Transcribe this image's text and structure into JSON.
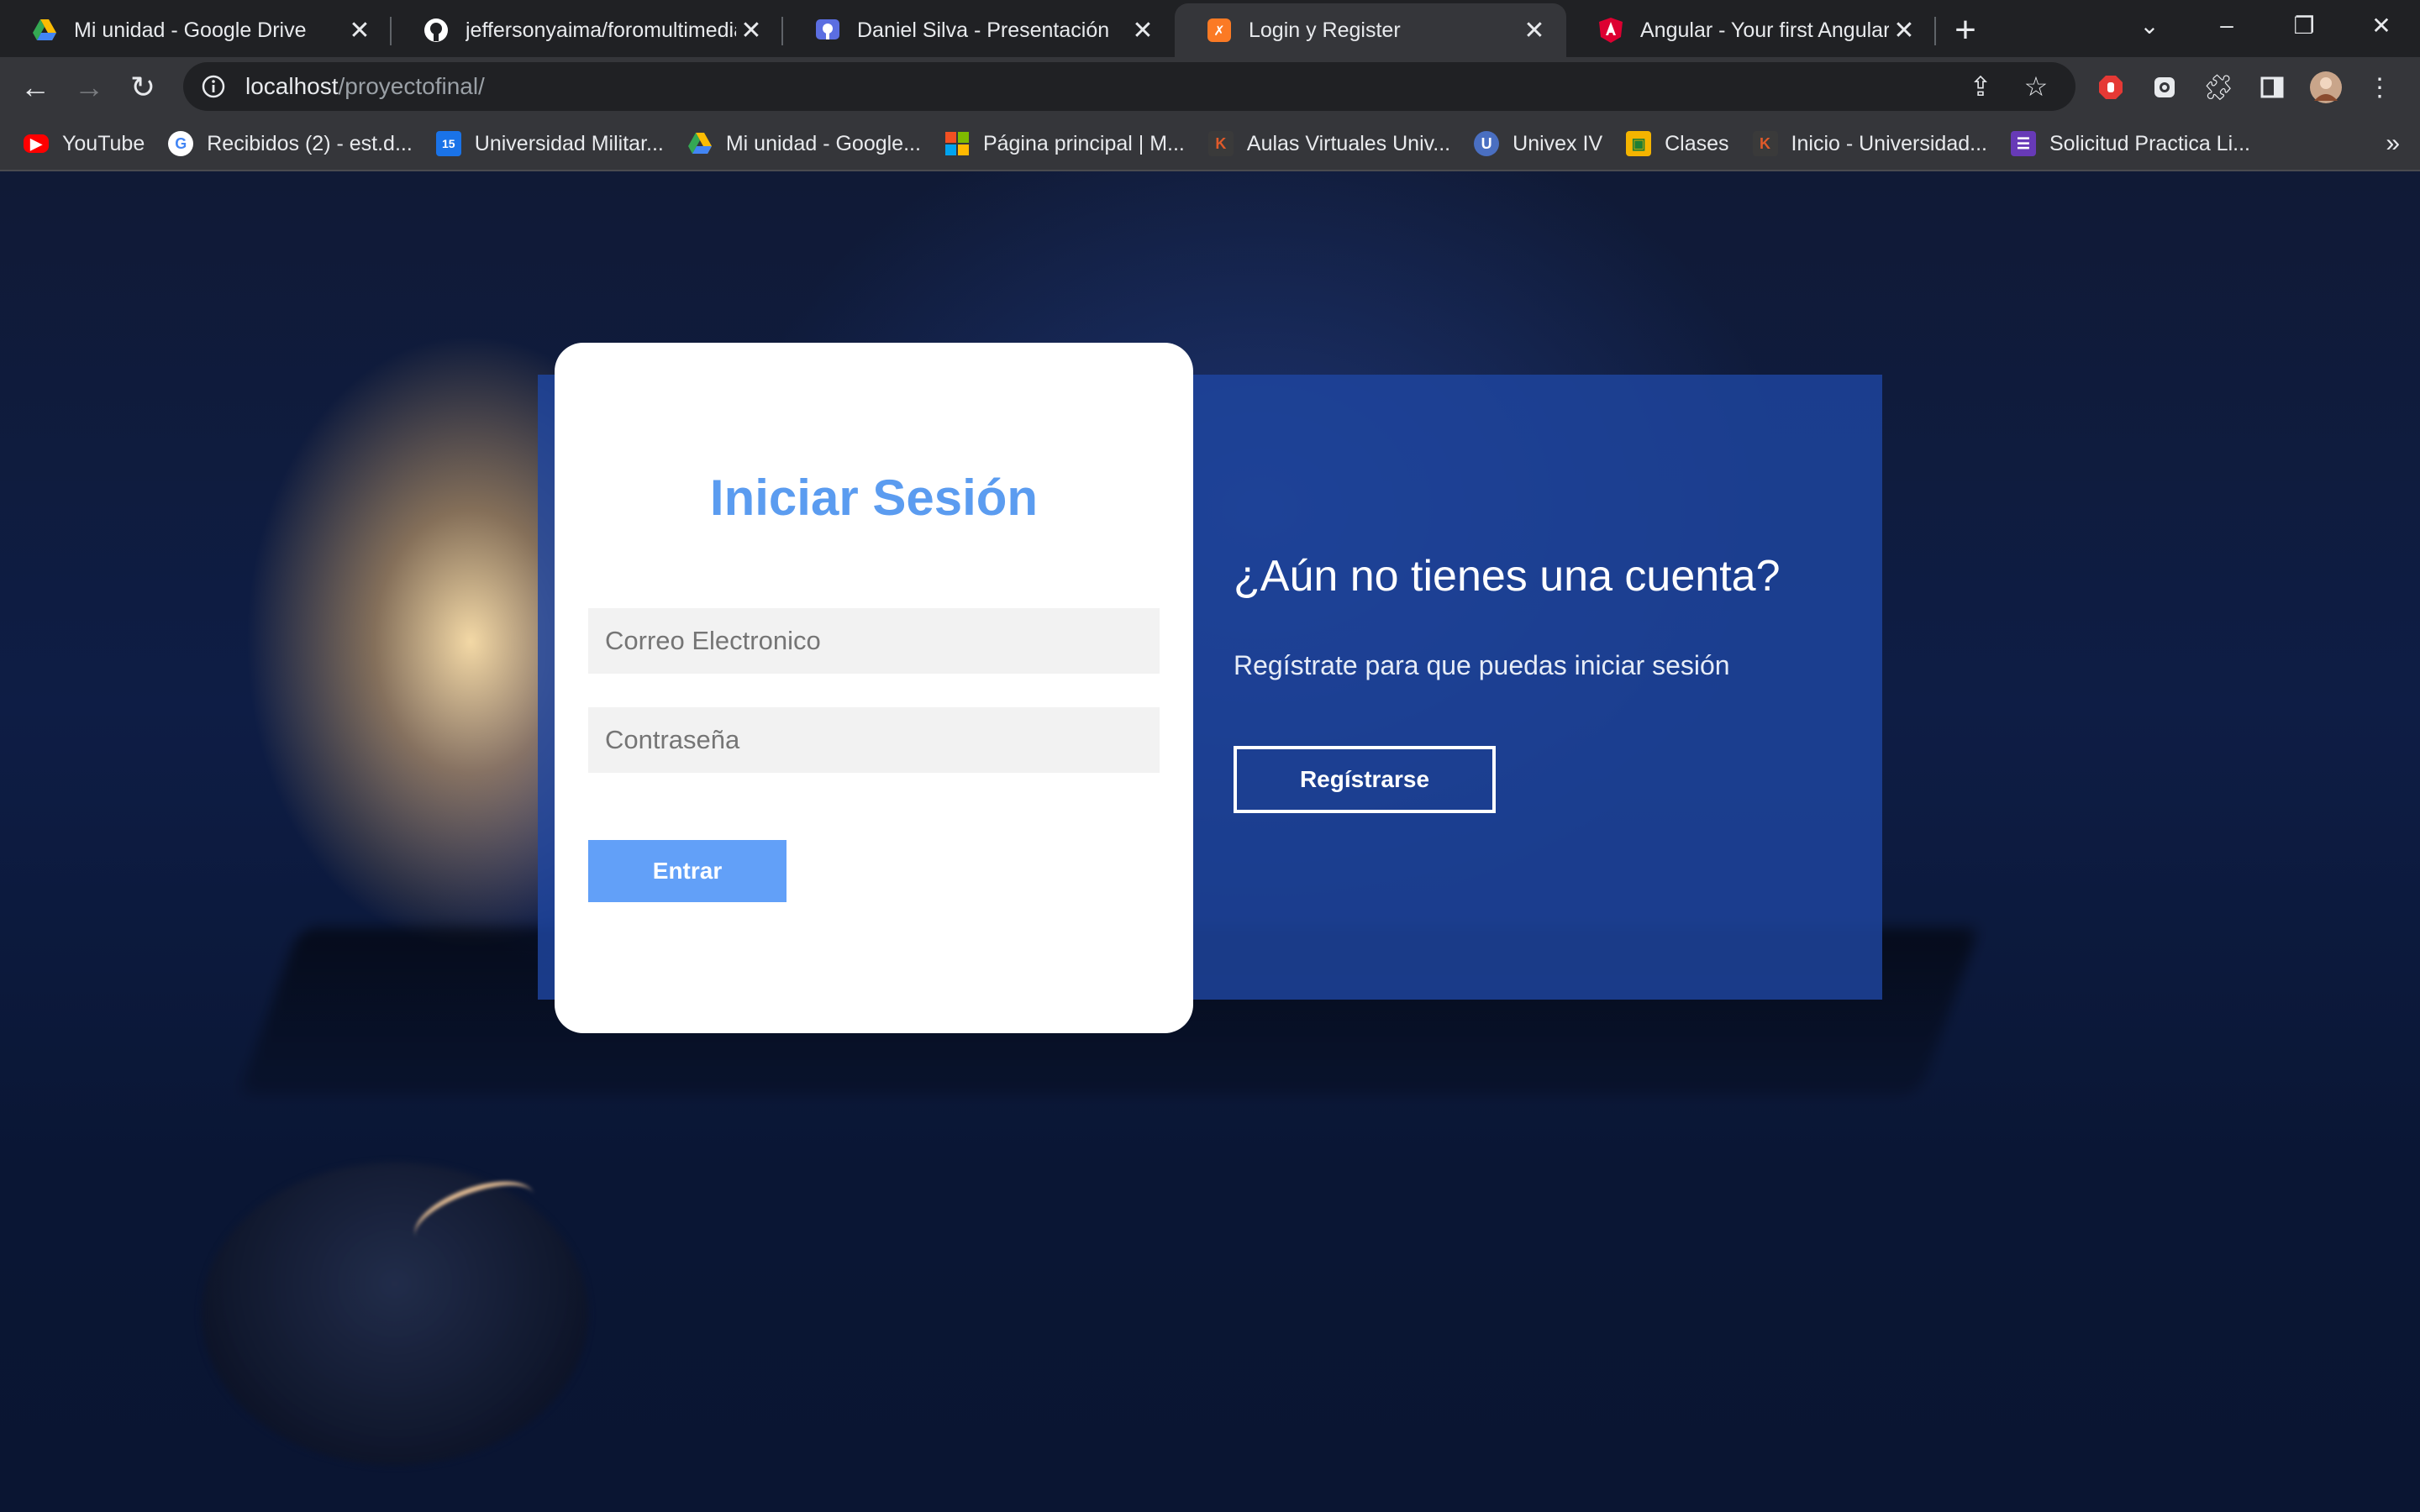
{
  "tabs": [
    {
      "title": "Mi unidad - Google Drive",
      "icon": "google-drive-icon",
      "active": false
    },
    {
      "title": "jeffersonyaima/foromultimedia",
      "icon": "github-icon",
      "active": false
    },
    {
      "title": "Daniel Silva - Presentación",
      "icon": "presentation-icon",
      "active": false
    },
    {
      "title": "Login y Register",
      "icon": "xampp-icon",
      "active": true
    },
    {
      "title": "Angular - Your first Angular app",
      "icon": "angular-icon",
      "active": false
    }
  ],
  "address_bar": {
    "host": "localhost",
    "path": "/proyectofinal/"
  },
  "bookmarks": [
    {
      "label": "YouTube",
      "icon": "youtube-icon",
      "color": "#ff0000"
    },
    {
      "label": "Recibidos (2) - est.d...",
      "icon": "google-icon",
      "color": "#ffffff"
    },
    {
      "label": "Universidad Militar...",
      "icon": "calendar-icon",
      "color": "#1a73e8"
    },
    {
      "label": "Mi unidad - Google...",
      "icon": "google-drive-icon",
      "color": "#34a853"
    },
    {
      "label": "Página principal | M...",
      "icon": "microsoft-icon",
      "color": "#f25022"
    },
    {
      "label": "Aulas Virtuales Univ...",
      "icon": "moodle-icon",
      "color": "#e05a2a"
    },
    {
      "label": "Univex IV",
      "icon": "univex-icon",
      "color": "#4a6fc1"
    },
    {
      "label": "Clases",
      "icon": "classroom-icon",
      "color": "#f4b400"
    },
    {
      "label": "Inicio - Universidad...",
      "icon": "moodle-icon",
      "color": "#e05a2a"
    },
    {
      "label": "Solicitud Practica Li...",
      "icon": "forms-icon",
      "color": "#673ab7"
    }
  ],
  "login": {
    "title": "Iniciar Sesión",
    "email_placeholder": "Correo Electronico",
    "password_placeholder": "Contraseña",
    "submit_label": "Entrar"
  },
  "register": {
    "question": "¿Aún no tienes una cuenta?",
    "subtitle": "Regístrate para que puedas iniciar sesión",
    "button_label": "Regístrarse"
  },
  "colors": {
    "title_blue": "#5b9cf0",
    "button_blue": "#62a0f8",
    "panel_blue": "#1e46a0"
  }
}
